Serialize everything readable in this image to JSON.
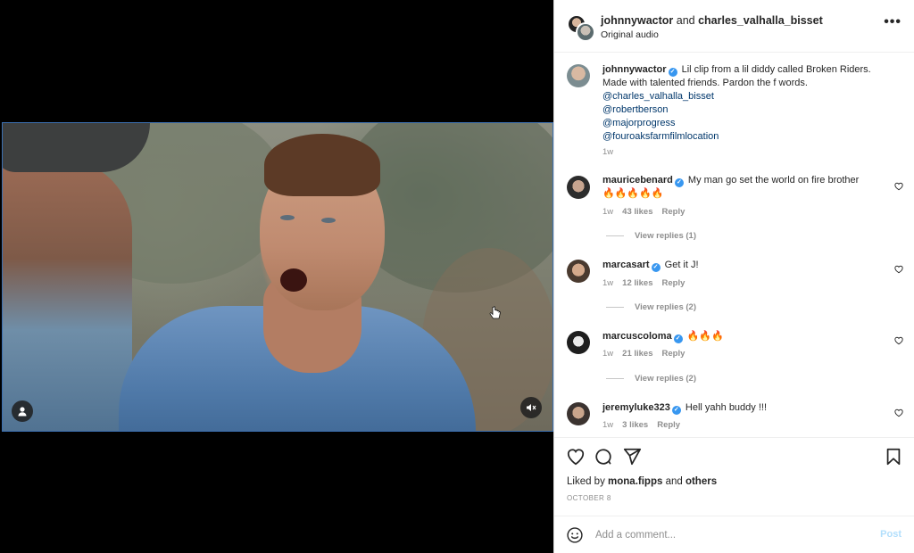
{
  "colors": {
    "accent": "#3897f0",
    "mention": "#00376b",
    "muted": "#8e8e8e",
    "post_disabled": "#b2dffc"
  },
  "icons": {
    "user_tag": "user-icon",
    "mute": "speaker-muted-icon",
    "more": "more-horizontal-icon",
    "verified": "verified-badge-icon",
    "like": "heart-icon",
    "comment": "comment-bubble-icon",
    "share": "paper-plane-icon",
    "save": "bookmark-icon",
    "emoji": "smiley-icon"
  },
  "header": {
    "user1": "johnnywactor",
    "and": " and ",
    "user2": "charles_valhalla_bisset",
    "audio": "Original audio",
    "more": "•••"
  },
  "caption": {
    "username": "johnnywactor",
    "text": " Lil clip from a lil diddy called Broken Riders. Made with talented friends. Pardon the f words.",
    "mentions": [
      "@charles_valhalla_bisset",
      "@robertberson",
      "@majorprogress",
      "@fouroaksfarmfilmlocation"
    ],
    "time": "1w"
  },
  "comments": [
    {
      "username": "mauricebenard",
      "text": " My man go set the world on fire brother",
      "text2": "🔥🔥🔥🔥🔥",
      "time": "1w",
      "likes": "43 likes",
      "reply": "Reply",
      "view_replies": "View replies (1)"
    },
    {
      "username": "marcasart",
      "text": " Get it J!",
      "time": "1w",
      "likes": "12 likes",
      "reply": "Reply",
      "view_replies": "View replies (2)"
    },
    {
      "username": "marcuscoloma",
      "text": " 🔥🔥🔥",
      "time": "1w",
      "likes": "21 likes",
      "reply": "Reply",
      "view_replies": "View replies (2)"
    },
    {
      "username": "jeremyluke323",
      "text": " Hell yahh buddy !!!",
      "time": "1w",
      "likes": "3 likes",
      "reply": "Reply"
    }
  ],
  "likes": {
    "prefix": "Liked by ",
    "user": "mona.fipps",
    "and": " and ",
    "others": "others"
  },
  "date": "OCTOBER 8",
  "comment_box": {
    "placeholder": "Add a comment...",
    "post": "Post"
  }
}
